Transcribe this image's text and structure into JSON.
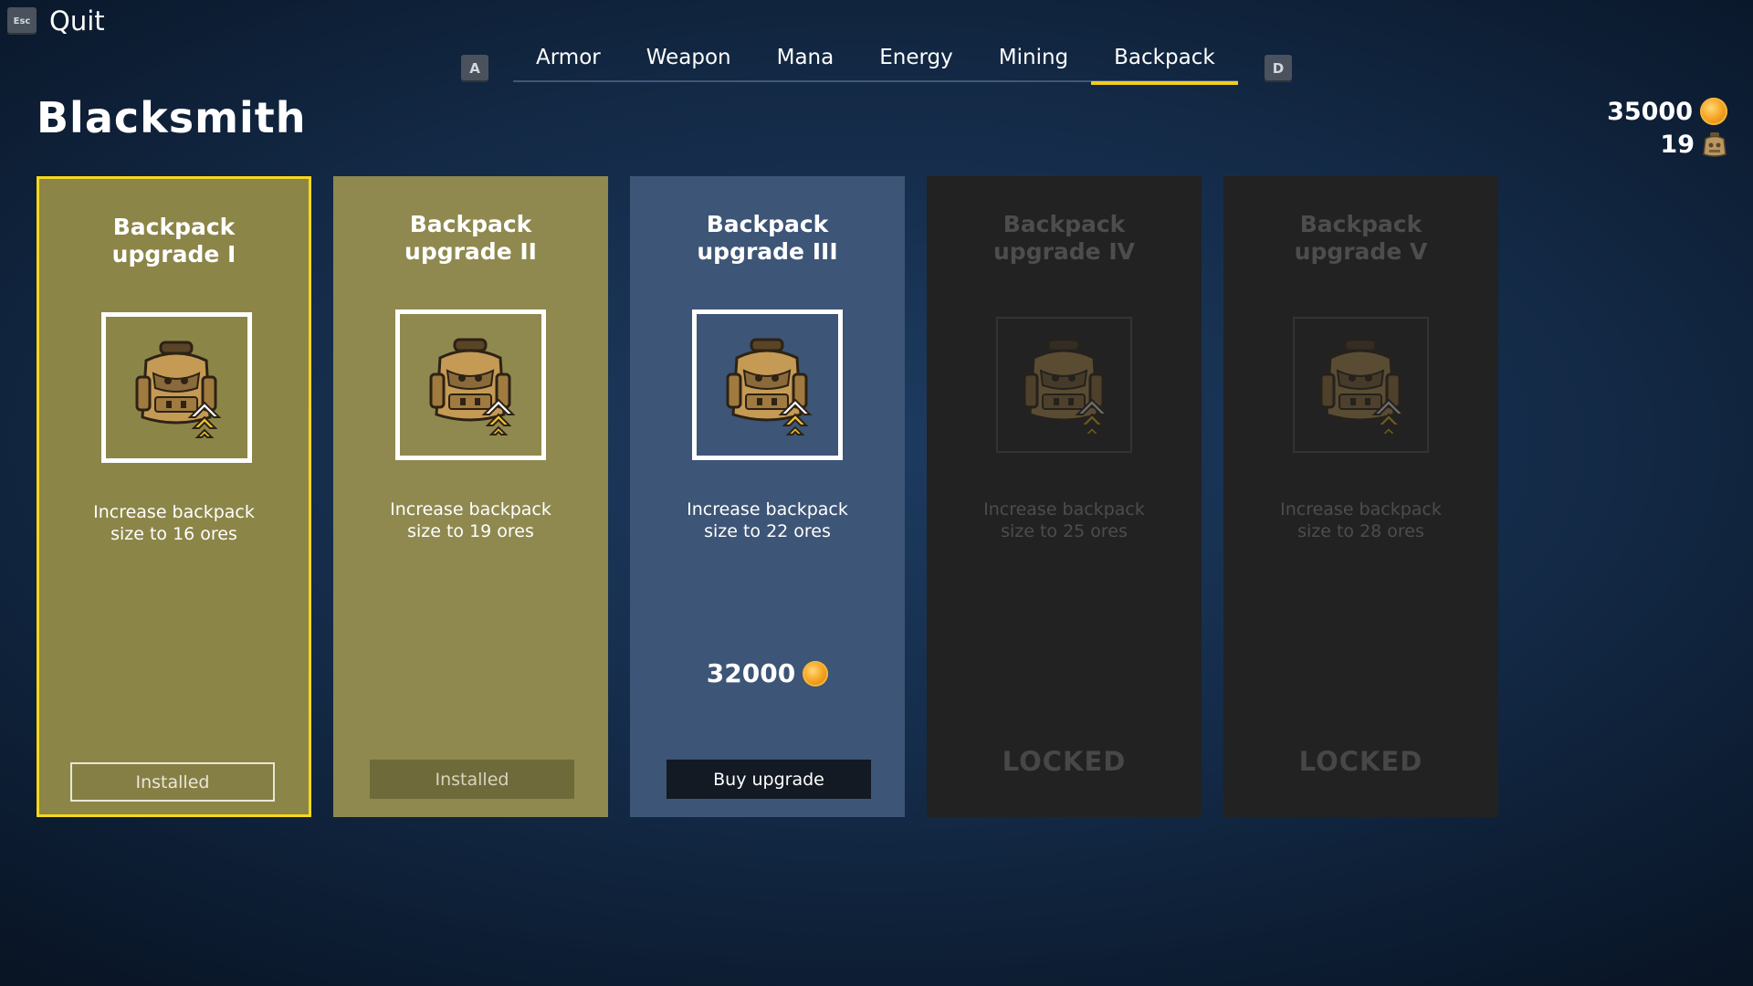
{
  "header": {
    "quit_key": "Esc",
    "quit_label": "Quit",
    "prev_key": "A",
    "next_key": "D",
    "title": "Blacksmith"
  },
  "tabs": [
    {
      "label": "Armor",
      "active": false
    },
    {
      "label": "Weapon",
      "active": false
    },
    {
      "label": "Mana",
      "active": false
    },
    {
      "label": "Energy",
      "active": false
    },
    {
      "label": "Mining",
      "active": false
    },
    {
      "label": "Backpack",
      "active": true
    }
  ],
  "wallet": {
    "coins": "35000",
    "coin_icon": "gold-coin-icon",
    "ores": "19",
    "ore_icon": "ore-bag-icon"
  },
  "cards": [
    {
      "title": "Backpack\nupgrade I",
      "desc": "Increase backpack\nsize to 16 ores",
      "status": "installed",
      "button": "Installed",
      "icon": "backpack-upgrade-icon"
    },
    {
      "title": "Backpack\nupgrade II",
      "desc": "Increase backpack\nsize to 19 ores",
      "status": "installed",
      "button": "Installed",
      "icon": "backpack-upgrade-icon"
    },
    {
      "title": "Backpack\nupgrade III",
      "desc": "Increase backpack\nsize to 22 ores",
      "status": "available",
      "price": "32000",
      "button": "Buy upgrade",
      "icon": "backpack-upgrade-icon"
    },
    {
      "title": "Backpack\nupgrade IV",
      "desc": "Increase backpack\nsize to 25 ores",
      "status": "locked",
      "locked_label": "LOCKED",
      "icon": "backpack-upgrade-icon"
    },
    {
      "title": "Backpack\nupgrade V",
      "desc": "Increase backpack\nsize to 28 ores",
      "status": "locked",
      "locked_label": "LOCKED",
      "icon": "backpack-upgrade-icon"
    }
  ],
  "colors": {
    "accent_yellow": "#f7d71e",
    "installed_card": "#8f894f",
    "available_card": "#3d5576",
    "locked_card": "#222222"
  }
}
